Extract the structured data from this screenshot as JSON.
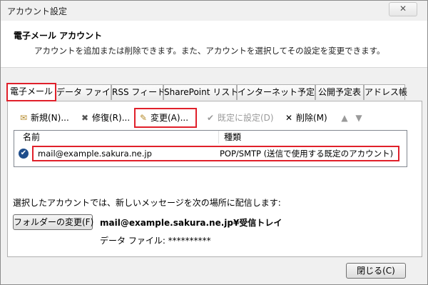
{
  "window": {
    "title": "アカウント設定",
    "close_glyph": "✕"
  },
  "header": {
    "title": "電子メール アカウント",
    "subtitle": "アカウントを追加または削除できます。また、アカウントを選択してその設定を変更できます。"
  },
  "tabs": [
    {
      "label": "電子メール",
      "active": true,
      "highlighted": true
    },
    {
      "label": "データ ファイル"
    },
    {
      "label": "RSS フィード"
    },
    {
      "label": "SharePoint リスト"
    },
    {
      "label": "インターネット予定表"
    },
    {
      "label": "公開予定表"
    },
    {
      "label": "アドレス帳"
    }
  ],
  "toolbar": {
    "new_label": "新規(N)...",
    "repair_label": "修復(R)...",
    "change_label": "変更(A)...",
    "default_label": "既定に設定(D)",
    "delete_label": "削除(M)"
  },
  "accounts_list": {
    "columns": {
      "name": "名前",
      "type": "種類"
    },
    "rows": [
      {
        "name": "mail@example.sakura.ne.jp",
        "type": "POP/SMTP (送信で使用する既定のアカウント)"
      }
    ]
  },
  "delivery": {
    "description": "選択したアカウントでは、新しいメッセージを次の場所に配信します:",
    "change_folder_label": "フォルダーの変更(F)",
    "location": "mail@example.sakura.ne.jp¥受信トレイ",
    "data_file_label": "データ ファイル: **********"
  },
  "footer": {
    "close_label": "閉じる(C)"
  },
  "colors": {
    "highlight": "#e0202a",
    "icon_blue": "#1f4e8c"
  }
}
